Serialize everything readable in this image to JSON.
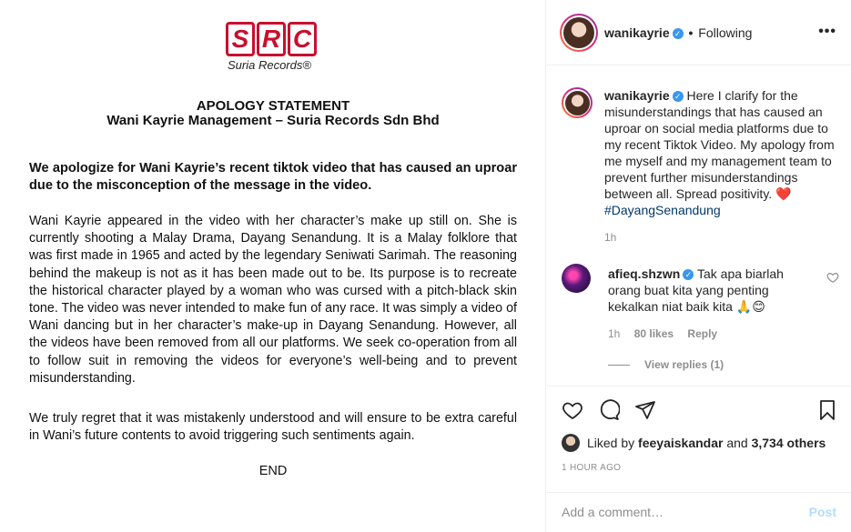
{
  "media": {
    "logo": {
      "text": "SRC",
      "subtitle": "Suria Records®"
    },
    "title_line1": "APOLOGY STATEMENT",
    "title_line2": "Wani Kayrie Management – Suria Records Sdn Bhd",
    "bold_paragraph": "We apologize for Wani Kayrie’s recent tiktok video that has caused an uproar due to the misconception of the message in the video.",
    "main_paragraph": "Wani Kayrie appeared in the video with her character’s make up still on. She is currently shooting a Malay Drama, Dayang Senandung. It is a Malay folklore that was first made in 1965 and acted by the legendary Seniwati Sarimah. The reasoning behind the makeup is not as it has been made out to be. Its purpose is to recreate the historical character played by a woman who was cursed with a pitch-black skin tone. The video was never intended to make fun of any race. It was simply a video of Wani dancing but in her character’s make-up in Dayang Senandung. However, all the videos have been removed from all our platforms. We seek co-operation from all to follow suit in removing the videos for everyone’s well-being and to prevent misunderstanding.",
    "regret_paragraph": "We truly regret that it was mistakenly understood and will ensure to be extra careful in Wani’s future contents to avoid triggering such sentiments again.",
    "end": "END"
  },
  "header": {
    "username": "wanikayrie",
    "separator": "•",
    "follow_status": "Following",
    "more": "•••"
  },
  "caption": {
    "username": "wanikayrie",
    "text": "Here I clarify for the misunderstandings that has caused an uproar on social media platforms due to my recent Tiktok Video. My apology from me myself and my management team to prevent further misunderstandings between all. Spread positivity.",
    "heart": "❤️",
    "hashtag": "#DayangSenandung",
    "time": "1h"
  },
  "comment": {
    "username": "afieq.shzwn",
    "text": "Tak apa biarlah orang buat kita yang penting kekalkan niat baik kita 🙏😊",
    "time": "1h",
    "likes": "80 likes",
    "reply": "Reply",
    "view_replies": "View replies (1)"
  },
  "actions": {
    "liked_prefix": "Liked by",
    "liked_user": "feeyaiskandar",
    "liked_and": "and",
    "liked_others": "3,734 others",
    "time_ago": "1 HOUR AGO",
    "comment_placeholder": "Add a comment…",
    "post": "Post"
  },
  "colors": {
    "brand_red": "#c8102e",
    "verified_blue": "#3897f0",
    "hashtag": "#00376b",
    "muted": "#8e8e8e",
    "post_disabled": "#b3dbff"
  }
}
